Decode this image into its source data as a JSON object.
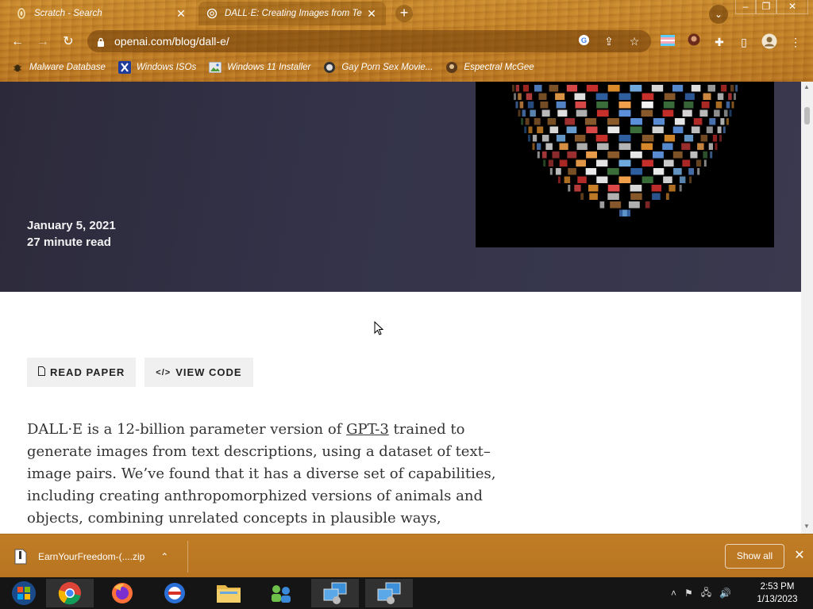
{
  "browser": {
    "tabs": [
      {
        "title": "Scratch - Search",
        "active": false,
        "icon": "ringed-favicon"
      },
      {
        "title": "DALL·E: Creating Images from Te",
        "active": true,
        "icon": "openai-logo"
      }
    ],
    "url": "openai.com/blog/dall-e/",
    "bookmarks": [
      {
        "label": "Malware Database",
        "icon": "bug-icon"
      },
      {
        "label": "Windows ISOs",
        "icon": "x-logo"
      },
      {
        "label": "Windows 11 Installer",
        "icon": "image-icon"
      },
      {
        "label": "Gay Porn Sex Movie...",
        "icon": "globe-icon"
      },
      {
        "label": "Espectral McGee",
        "icon": "avatar-icon"
      }
    ]
  },
  "hero": {
    "date": "January 5, 2021",
    "read_time": "27 minute read"
  },
  "buttons": {
    "read_paper": "READ PAPER",
    "view_code": "VIEW CODE"
  },
  "article": {
    "p1_before_link": "DALL·E is a 12-billion parameter version of ",
    "p1_link": "GPT-3",
    "p1_after_link": " trained to generate images from text descriptions, using a dataset of text–image pairs. We’ve found that it has a diverse set of capabilities, including creating anthropomorphized versions of animals and objects, combining unrelated concepts in plausible ways, rendering text, and applying"
  },
  "download": {
    "filename": "EarnYourFreedom-(....zip",
    "show_all": "Show all"
  },
  "clock": {
    "time": "2:53 PM",
    "date": "1/13/2023"
  },
  "colors": {
    "chrome": "#c17f26",
    "hero_bg": "#2c2a3a",
    "taskbar": "#151515"
  }
}
